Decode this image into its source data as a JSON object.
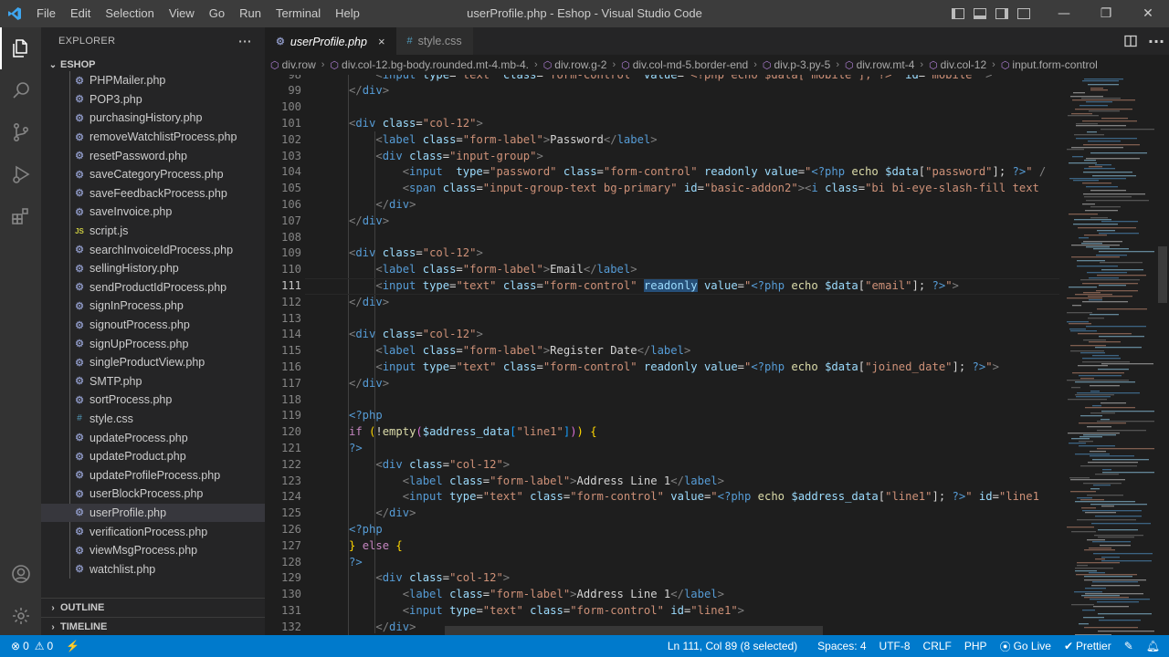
{
  "titlebar": {
    "menu": [
      "File",
      "Edit",
      "Selection",
      "View",
      "Go",
      "Run",
      "Terminal",
      "Help"
    ],
    "window_title": "userProfile.php - Eshop - Visual Studio Code",
    "minimize": "—",
    "restore": "❐",
    "close": "✕"
  },
  "sidebar": {
    "title": "EXPLORER",
    "more": "···",
    "folder": "ESHOP",
    "files": [
      {
        "name": "PHPMailer.php",
        "type": "php"
      },
      {
        "name": "POP3.php",
        "type": "php"
      },
      {
        "name": "purchasingHistory.php",
        "type": "php"
      },
      {
        "name": "removeWatchlistProcess.php",
        "type": "php"
      },
      {
        "name": "resetPassword.php",
        "type": "php"
      },
      {
        "name": "saveCategoryProcess.php",
        "type": "php"
      },
      {
        "name": "saveFeedbackProcess.php",
        "type": "php"
      },
      {
        "name": "saveInvoice.php",
        "type": "php"
      },
      {
        "name": "script.js",
        "type": "js"
      },
      {
        "name": "searchInvoiceIdProcess.php",
        "type": "php"
      },
      {
        "name": "sellingHistory.php",
        "type": "php"
      },
      {
        "name": "sendProductIdProcess.php",
        "type": "php"
      },
      {
        "name": "signInProcess.php",
        "type": "php"
      },
      {
        "name": "signoutProcess.php",
        "type": "php"
      },
      {
        "name": "signUpProcess.php",
        "type": "php"
      },
      {
        "name": "singleProductView.php",
        "type": "php"
      },
      {
        "name": "SMTP.php",
        "type": "php"
      },
      {
        "name": "sortProcess.php",
        "type": "php"
      },
      {
        "name": "style.css",
        "type": "css"
      },
      {
        "name": "updateProcess.php",
        "type": "php"
      },
      {
        "name": "updateProduct.php",
        "type": "php"
      },
      {
        "name": "updateProfileProcess.php",
        "type": "php"
      },
      {
        "name": "userBlockProcess.php",
        "type": "php"
      },
      {
        "name": "userProfile.php",
        "type": "php",
        "selected": true
      },
      {
        "name": "verificationProcess.php",
        "type": "php"
      },
      {
        "name": "viewMsgProcess.php",
        "type": "php"
      },
      {
        "name": "watchlist.php",
        "type": "php"
      }
    ],
    "outline": "OUTLINE",
    "timeline": "TIMELINE"
  },
  "tabs": [
    {
      "label": "userProfile.php",
      "icon": "php-icon",
      "active": true
    },
    {
      "label": "style.css",
      "icon": "css-icon",
      "active": false
    }
  ],
  "breadcrumb": [
    "div.row",
    "div.col-12.bg-body.rounded.mt-4.mb-4.",
    "div.row.g-2",
    "div.col-md-5.border-end",
    "div.p-3.py-5",
    "div.row.mt-4",
    "div.col-12",
    "input.form-control"
  ],
  "editor": {
    "current_line": 111
  },
  "statusbar": {
    "errors": "0",
    "warnings": "0",
    "position": "Ln 111, Col 89 (8 selected)",
    "spaces": "Spaces: 4",
    "encoding": "UTF-8",
    "eol": "CRLF",
    "language": "PHP",
    "golive": "Go Live",
    "prettier": "Prettier"
  },
  "colors": {
    "statusbar": "#007acc",
    "activitybar": "#333333",
    "sidebar": "#252526",
    "editor": "#1e1e1e"
  }
}
